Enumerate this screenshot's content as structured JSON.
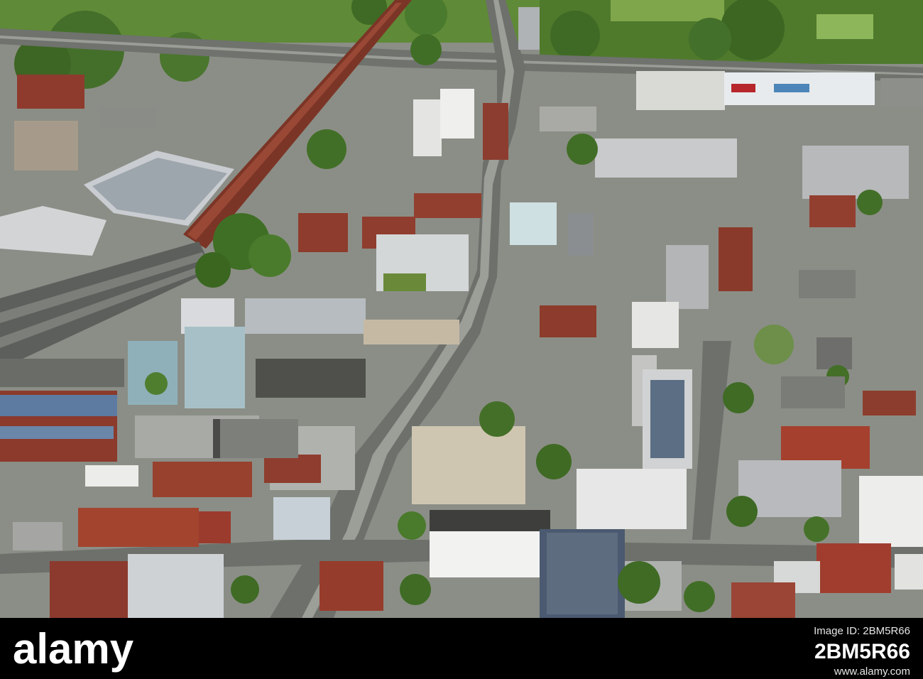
{
  "watermark": {
    "brand": "alamy",
    "image_id_label": "Image ID: 2BM5R66",
    "image_id": "2BM5R66",
    "site": "www.alamy.com"
  },
  "colors": {
    "bar_background": "#000000",
    "bar_text": "#ffffff",
    "brick": "#8c3b2c",
    "foliage": "#4f7a2c",
    "roof_grey": "#b3b5b0",
    "rail": "#5d5f5c"
  },
  "photo": {
    "subject": "aerial-town-centre-view"
  }
}
